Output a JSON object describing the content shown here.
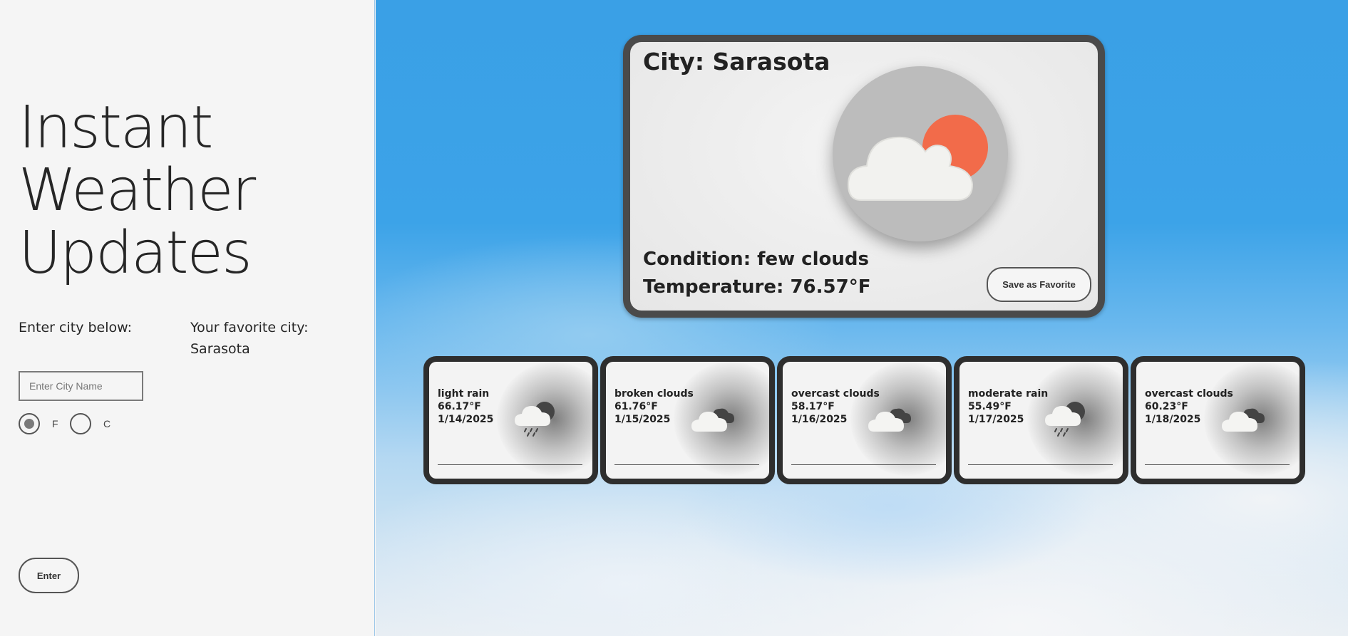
{
  "header": {
    "title_lines": [
      "Instant",
      "Weather",
      "Updates"
    ]
  },
  "form": {
    "enter_label": "Enter city below:",
    "city_placeholder": "Enter City Name",
    "city_value": "",
    "unit_f_label": "F",
    "unit_c_label": "C",
    "selected_unit": "F",
    "enter_button_label": "Enter"
  },
  "favorite": {
    "label": "Your favorite city:",
    "city": "Sarasota"
  },
  "current": {
    "city": "City: Sarasota",
    "condition": "Condition: few clouds",
    "temperature": "Temperature: 76.57°F",
    "icon": "few-clouds-icon",
    "save_button_label": "Save as Favorite",
    "sun_color": "#f26b4a"
  },
  "forecast": [
    {
      "condition": "light rain",
      "temp": "66.17°F",
      "date": "1/14/2025",
      "icon": "rain-icon"
    },
    {
      "condition": "broken clouds",
      "temp": "61.76°F",
      "date": "1/15/2025",
      "icon": "broken-clouds-icon"
    },
    {
      "condition": "overcast clouds",
      "temp": "58.17°F",
      "date": "1/16/2025",
      "icon": "broken-clouds-icon"
    },
    {
      "condition": "moderate rain",
      "temp": "55.49°F",
      "date": "1/17/2025",
      "icon": "rain-icon"
    },
    {
      "condition": "overcast clouds",
      "temp": "60.23°F",
      "date": "1/18/2025",
      "icon": "broken-clouds-icon"
    }
  ]
}
